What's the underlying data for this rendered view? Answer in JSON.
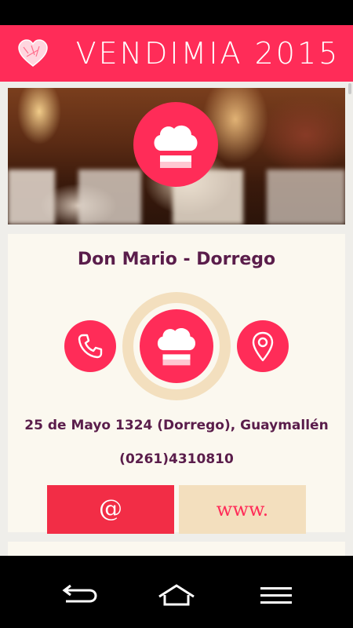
{
  "app": {
    "title": "VENDIMIA 2015",
    "accent_color": "#ff2c58",
    "logo_icon": "heart-icon"
  },
  "hero": {
    "image": "restaurant-interior-photo",
    "badge_icon": "chef-hat-icon"
  },
  "restaurant": {
    "name": "Don Mario - Dorrego",
    "address": "25 de Mayo 1324 (Dorrego), Guaymallén",
    "phone": "(0261)4310810"
  },
  "actions": {
    "call_icon": "phone-icon",
    "center_icon": "chef-hat-icon",
    "map_icon": "map-pin-icon",
    "email_label": "@",
    "web_label": "www."
  },
  "navbar": {
    "back_icon": "back-icon",
    "home_icon": "home-icon",
    "menu_icon": "menu-icon"
  }
}
